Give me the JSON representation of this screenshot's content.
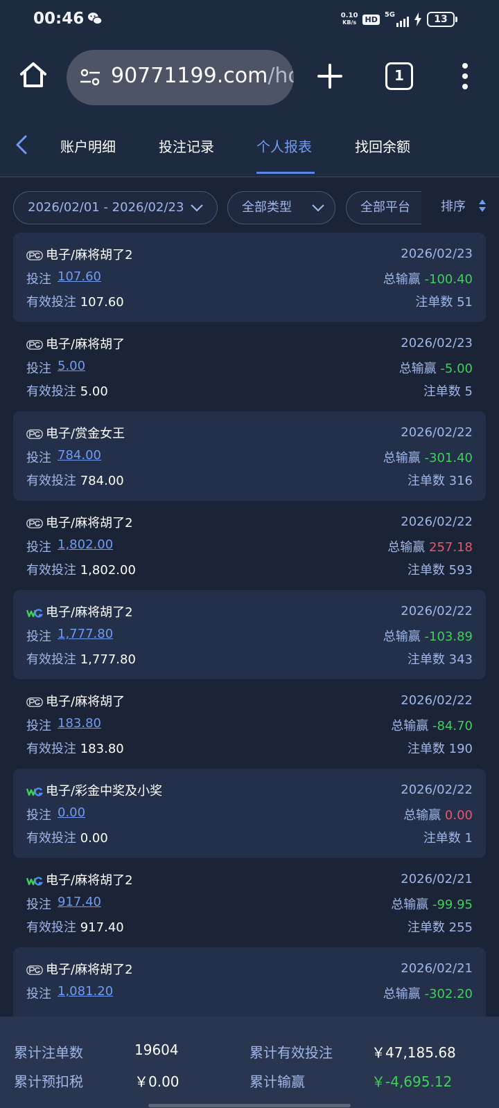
{
  "status_bar": {
    "time": "00:46",
    "net_speed_value": "0.10",
    "net_speed_unit": "KB/s",
    "hd": "HD",
    "signal": "5G",
    "battery": "13"
  },
  "browser": {
    "url_main": "90771199.com",
    "url_rest": "/ho",
    "tab_count": "1"
  },
  "tabs": [
    {
      "label": "账户明细"
    },
    {
      "label": "投注记录"
    },
    {
      "label": "个人报表"
    },
    {
      "label": "找回余额"
    }
  ],
  "active_tab": 2,
  "filters": {
    "date_range": "2026/02/01 - 2026/02/23",
    "type": "全部类型",
    "platform": "全部平台",
    "sort": "排序"
  },
  "labels": {
    "bet": "投注",
    "valid_bet": "有效投注",
    "total_win": "总输赢",
    "order_count": "注单数"
  },
  "records": [
    {
      "logo": "PG",
      "game": "电子/麻将胡了2",
      "date": "2026/02/23",
      "bet": "107.60",
      "win": "-100.40",
      "valid": "107.60",
      "count": "51"
    },
    {
      "logo": "PG",
      "game": "电子/麻将胡了",
      "date": "2026/02/23",
      "bet": "5.00",
      "win": "-5.00",
      "valid": "5.00",
      "count": "5"
    },
    {
      "logo": "PG",
      "game": "电子/赏金女王",
      "date": "2026/02/22",
      "bet": "784.00",
      "win": "-301.40",
      "valid": "784.00",
      "count": "316"
    },
    {
      "logo": "PG",
      "game": "电子/麻将胡了2",
      "date": "2026/02/22",
      "bet": "1,802.00",
      "win": "257.18",
      "valid": "1,802.00",
      "count": "593"
    },
    {
      "logo": "WG",
      "game": "电子/麻将胡了2",
      "date": "2026/02/22",
      "bet": "1,777.80",
      "win": "-103.89",
      "valid": "1,777.80",
      "count": "343"
    },
    {
      "logo": "PG",
      "game": "电子/麻将胡了",
      "date": "2026/02/22",
      "bet": "183.80",
      "win": "-84.70",
      "valid": "183.80",
      "count": "190"
    },
    {
      "logo": "WG",
      "game": "电子/彩金中奖及小奖",
      "date": "2026/02/22",
      "bet": "0.00",
      "win": "0.00",
      "valid": "0.00",
      "count": "1"
    },
    {
      "logo": "WG",
      "game": "电子/麻将胡了2",
      "date": "2026/02/21",
      "bet": "917.40",
      "win": "-99.95",
      "valid": "917.40",
      "count": "255"
    },
    {
      "logo": "PG",
      "game": "电子/麻将胡了2",
      "date": "2026/02/21",
      "bet": "1,081.20",
      "win": "-302.20",
      "valid": "",
      "count": ""
    }
  ],
  "summary": {
    "total_orders_label": "累计注单数",
    "total_orders": "19604",
    "total_valid_label": "累计有效投注",
    "total_valid": "￥47,185.68",
    "tax_label": "累计预扣税",
    "tax": "￥0.00",
    "total_win_label": "累计输赢",
    "total_win": "￥-4,695.12"
  },
  "colors": {
    "background": "#1b2436",
    "header": "#1e2a3f",
    "card": "#243049",
    "accent_blue": "#6f9bf2",
    "loss_green": "#3fcf5a",
    "win_red": "#e8566a"
  },
  "icons": [
    "wechat-icon",
    "home-icon",
    "tune-icon",
    "plus-icon",
    "tab-switcher-icon",
    "more-vert-icon",
    "back-arrow-icon",
    "chevron-down-icon",
    "sort-icon",
    "pg-logo-icon",
    "wg-logo-icon"
  ]
}
